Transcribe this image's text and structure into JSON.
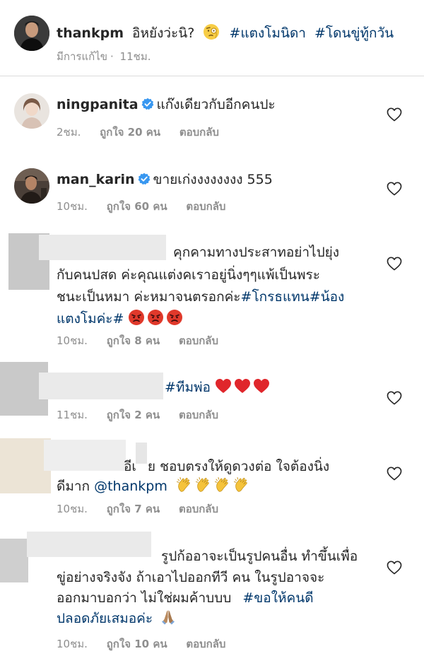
{
  "caption": {
    "username": "thankpm",
    "text": "อิหยังว่ะนิ?",
    "hashtags": [
      "#แตงโมนิดา",
      "#โดนขู่ทู้กวัน"
    ],
    "edited": "มีการแก้ไข",
    "time": "11ชม."
  },
  "comments": [
    {
      "username": "ningpanita",
      "verified": true,
      "lines": [
        "แก๊งเดียวกับอีกคนปะ"
      ],
      "time": "2ชม.",
      "likes": "ถูกใจ 20 คน",
      "reply": "ตอบกลับ"
    },
    {
      "username": "man_karin",
      "verified": true,
      "lines": [
        "ขายเก่งงงงงงงง 555"
      ],
      "time": "10ชม.",
      "likes": "ถูกใจ 60 คน",
      "reply": "ตอบกลับ"
    },
    {
      "username_hidden": true,
      "lines": [
        "คุกคามทางประสาทอย่าไปยุ่ง",
        "กับคนปสด ค่ะคุณแต่งคเราอยู่นิ่งๆๆแพ้เป็นพระ",
        "ชนะเป็นหมา ค่ะหมาจนตรอกค่ะ",
        "แตงโมค่ะ"
      ],
      "hashtags": [
        "#โกรธแทน",
        "#น้อง",
        "#"
      ],
      "emoji": [
        "angry-face",
        "angry-face",
        "angry-face"
      ],
      "time": "10ชม.",
      "likes": "ถูกใจ 8 คน",
      "reply": "ตอบกลับ"
    },
    {
      "username_hidden": true,
      "hashtags": [
        "#ทีมพ่อ"
      ],
      "emoji": [
        "red-heart",
        "red-heart",
        "red-heart"
      ],
      "time": "11ชม.",
      "likes": "ถูกใจ 2 คน",
      "reply": "ตอบกลับ"
    },
    {
      "username_hidden": true,
      "lines": [
        "อีเ",
        "ย  ชอบตรงให้ดูดวงต่อ  ใจต้องนิ่ง",
        "ดีมาก"
      ],
      "mention": "@thankpm",
      "emoji": [
        "clapping-hands",
        "clapping-hands",
        "clapping-hands",
        "clapping-hands"
      ],
      "time": "10ชม.",
      "likes": "ถูกใจ 7 คน",
      "reply": "ตอบกลับ"
    },
    {
      "username_hidden": true,
      "lines": [
        "รูปก้ออาจะเป็นรูปคนอื่น ทำขึ้นเพื่อ",
        "ขู่อย่างจริงจัง ถ้าเอาไปออกทีวี คน ในรูปอาจจะ",
        "ออกมาบอกว่า ไม่ใช่ผมค้าบบบ",
        "ปลอดภัยเสมอค่ะ"
      ],
      "hashtags": [
        "#ขอให้คนดี"
      ],
      "emoji": [
        "folded-hands"
      ],
      "time": "10ชม.",
      "likes": "ถูกใจ 10 คน",
      "reply": "ตอบกลับ"
    }
  ],
  "colors": {
    "text": "#262626",
    "meta": "#8e8e8e",
    "hashtag": "#00376b",
    "verified": "#3897f0",
    "divider": "#dbdbdb"
  },
  "icons": {
    "like": "heart-outline-icon",
    "verified": "verified-badge-icon",
    "caption_emoji": "face-with-monocle-emoji"
  }
}
